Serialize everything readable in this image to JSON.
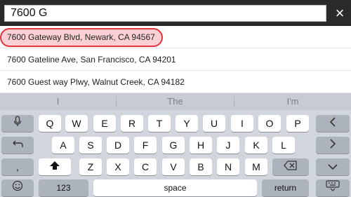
{
  "search": {
    "value": "7600 G",
    "close_icon": "×"
  },
  "results": [
    {
      "label": "7600 Gateway Blvd, Newark, CA 94567"
    },
    {
      "label": "7600 Gateline Ave, San Francisco, CA 94201"
    },
    {
      "label": "7600 Guest way Plwy, Walnut Creek, CA 94182"
    }
  ],
  "highlight_color": "#e0383e",
  "keyboard": {
    "predictions": [
      "I",
      "The",
      "I'm"
    ],
    "row1": [
      "Q",
      "W",
      "E",
      "R",
      "T",
      "Y",
      "U",
      "I",
      "O",
      "P"
    ],
    "row2": [
      "A",
      "S",
      "D",
      "F",
      "G",
      "H",
      "J",
      "K",
      "L"
    ],
    "row3": [
      "Z",
      "X",
      "C",
      "V",
      "B",
      "N",
      "M"
    ],
    "numbers_label": "123",
    "space_label": "space",
    "return_label": "return",
    "comma_label": ",",
    "icons": {
      "mic": "mic-icon",
      "undo": "undo-icon",
      "shift": "shift-icon",
      "delete": "delete-icon",
      "emoji": "emoji-icon",
      "left": "chevron-left-icon",
      "right": "chevron-right-icon",
      "down": "chevron-down-icon",
      "hide_keyboard": "keyboard-hide-icon"
    }
  }
}
